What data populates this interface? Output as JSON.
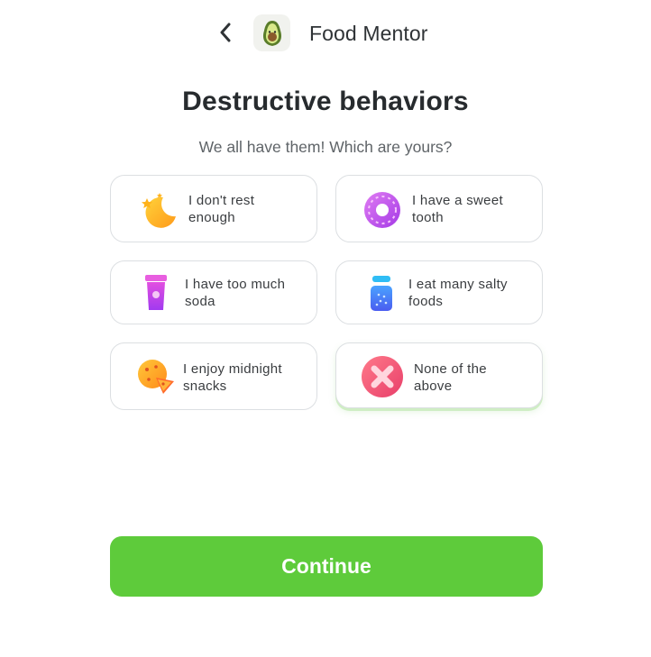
{
  "header": {
    "app_title": "Food Mentor",
    "back_icon": "chevron-left-icon",
    "logo_icon": "avocado-icon"
  },
  "page": {
    "title": "Destructive behaviors",
    "subtitle": "We all have them! Which are yours?"
  },
  "options": [
    {
      "label": "I don't rest enough",
      "icon": "moon-stars-icon",
      "selected": false
    },
    {
      "label": "I have a sweet tooth",
      "icon": "donut-icon",
      "selected": false
    },
    {
      "label": "I have too much soda",
      "icon": "soda-cup-icon",
      "selected": false
    },
    {
      "label": "I eat many salty foods",
      "icon": "salt-shaker-icon",
      "selected": false
    },
    {
      "label": "I enjoy midnight snacks",
      "icon": "pizza-icon",
      "selected": false
    },
    {
      "label": "None of the above",
      "icon": "cross-circle-icon",
      "selected": true
    }
  ],
  "continue_label": "Continue",
  "colors": {
    "accent": "#5ecb3b",
    "selected_glow": "#cfeec4",
    "border": "#dcdfe2"
  }
}
